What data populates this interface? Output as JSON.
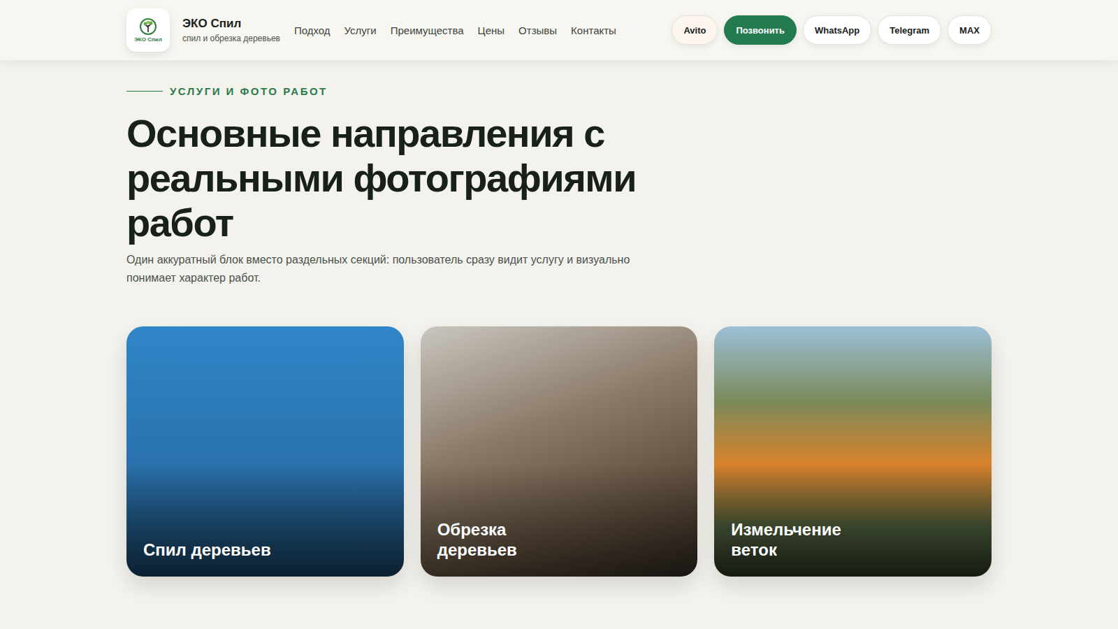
{
  "header": {
    "logo_mark": "ЭКО Спил",
    "brand": "ЭКО Спил",
    "tagline": "спил и обрезка деревьев",
    "nav": [
      "Подход",
      "Услуги",
      "Преимущества",
      "Цены",
      "Отзывы",
      "Контакты"
    ],
    "buttons": [
      {
        "label": "Avito",
        "kind": "warm"
      },
      {
        "label": "Позвонить",
        "kind": "primary"
      },
      {
        "label": "WhatsApp",
        "kind": "outline"
      },
      {
        "label": "Telegram",
        "kind": "outline"
      },
      {
        "label": "MAX",
        "kind": "outline"
      }
    ]
  },
  "section": {
    "eyebrow": "Услуги и фото работ",
    "title": "Основные направления с реальными фотографиями работ",
    "description": "Один аккуратный блок вместо раздельных секций: пользователь сразу видит услугу и визуально понимает характер работ."
  },
  "cards": [
    {
      "title": "Спил деревьев"
    },
    {
      "title": "Обрезка деревьев"
    },
    {
      "title": "Измельчение веток"
    }
  ]
}
